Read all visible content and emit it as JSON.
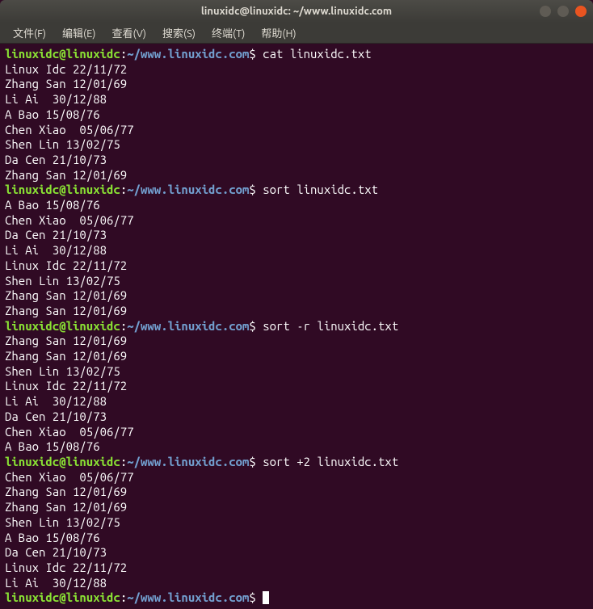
{
  "titlebar": {
    "title": "linuxidc@linuxidc: ~/www.linuxidc.com"
  },
  "menubar": {
    "items": [
      "文件(F)",
      "编辑(E)",
      "查看(V)",
      "搜索(S)",
      "终端(T)",
      "帮助(H)"
    ]
  },
  "prompt": {
    "user_host": "linuxidc@linuxidc",
    "colon": ":",
    "path": "~/www.linuxidc.com",
    "sigil": "$"
  },
  "sessions": [
    {
      "cmd": "cat linuxidc.txt",
      "output": [
        "Linux Idc 22/11/72",
        "Zhang San 12/01/69",
        "Li Ai  30/12/88",
        "A Bao 15/08/76",
        "Chen Xiao  05/06/77",
        "Shen Lin 13/02/75",
        "Da Cen 21/10/73",
        "Zhang San 12/01/69"
      ]
    },
    {
      "cmd": "sort linuxidc.txt",
      "output": [
        "A Bao 15/08/76",
        "Chen Xiao  05/06/77",
        "Da Cen 21/10/73",
        "Li Ai  30/12/88",
        "Linux Idc 22/11/72",
        "Shen Lin 13/02/75",
        "Zhang San 12/01/69",
        "Zhang San 12/01/69"
      ]
    },
    {
      "cmd": "sort -r linuxidc.txt",
      "output": [
        "Zhang San 12/01/69",
        "Zhang San 12/01/69",
        "Shen Lin 13/02/75",
        "Linux Idc 22/11/72",
        "Li Ai  30/12/88",
        "Da Cen 21/10/73",
        "Chen Xiao  05/06/77",
        "A Bao 15/08/76"
      ]
    },
    {
      "cmd": "sort +2 linuxidc.txt",
      "output": [
        "Chen Xiao  05/06/77",
        "Zhang San 12/01/69",
        "Zhang San 12/01/69",
        "Shen Lin 13/02/75",
        "A Bao 15/08/76",
        "Da Cen 21/10/73",
        "Linux Idc 22/11/72",
        "Li Ai  30/12/88"
      ]
    }
  ]
}
